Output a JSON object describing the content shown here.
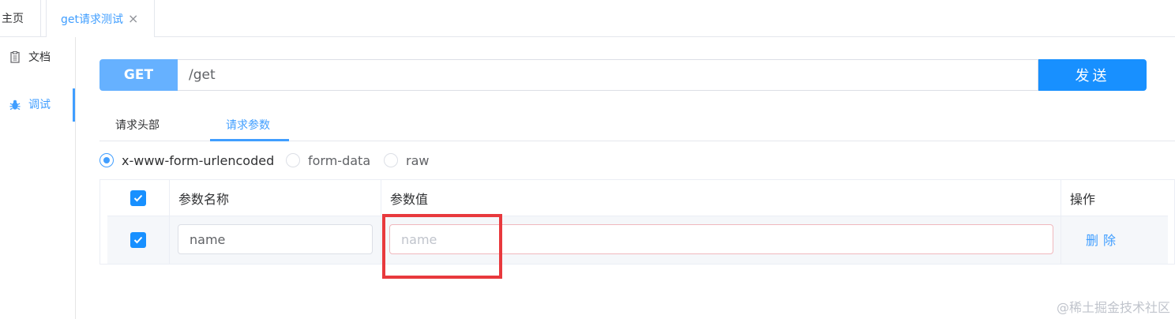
{
  "tabs": {
    "home": "主页",
    "active": "get请求测试",
    "close_glyph": "×"
  },
  "sidebar": {
    "items": [
      {
        "label": "文档",
        "icon": "document-icon"
      },
      {
        "label": "调试",
        "icon": "bug-icon",
        "active": true
      }
    ]
  },
  "request": {
    "method": "GET",
    "url": "/get",
    "send_label": "发送"
  },
  "section_tabs": [
    {
      "label": "请求头部"
    },
    {
      "label": "请求参数",
      "active": true
    }
  ],
  "body_types": [
    {
      "label": "x-www-form-urlencoded",
      "selected": true
    },
    {
      "label": "form-data",
      "selected": false
    },
    {
      "label": "raw",
      "selected": false
    }
  ],
  "params_table": {
    "headers": {
      "name": "参数名称",
      "value": "参数值",
      "action": "操作"
    },
    "rows": [
      {
        "checked": true,
        "name": "name",
        "value_placeholder": "name",
        "action": "删除"
      }
    ]
  },
  "watermark": "@稀土掘金技术社区",
  "colors": {
    "accent": "#409eff",
    "send_button": "#1890ff",
    "method_badge": "#66b1ff",
    "highlight": "#e8393d"
  }
}
